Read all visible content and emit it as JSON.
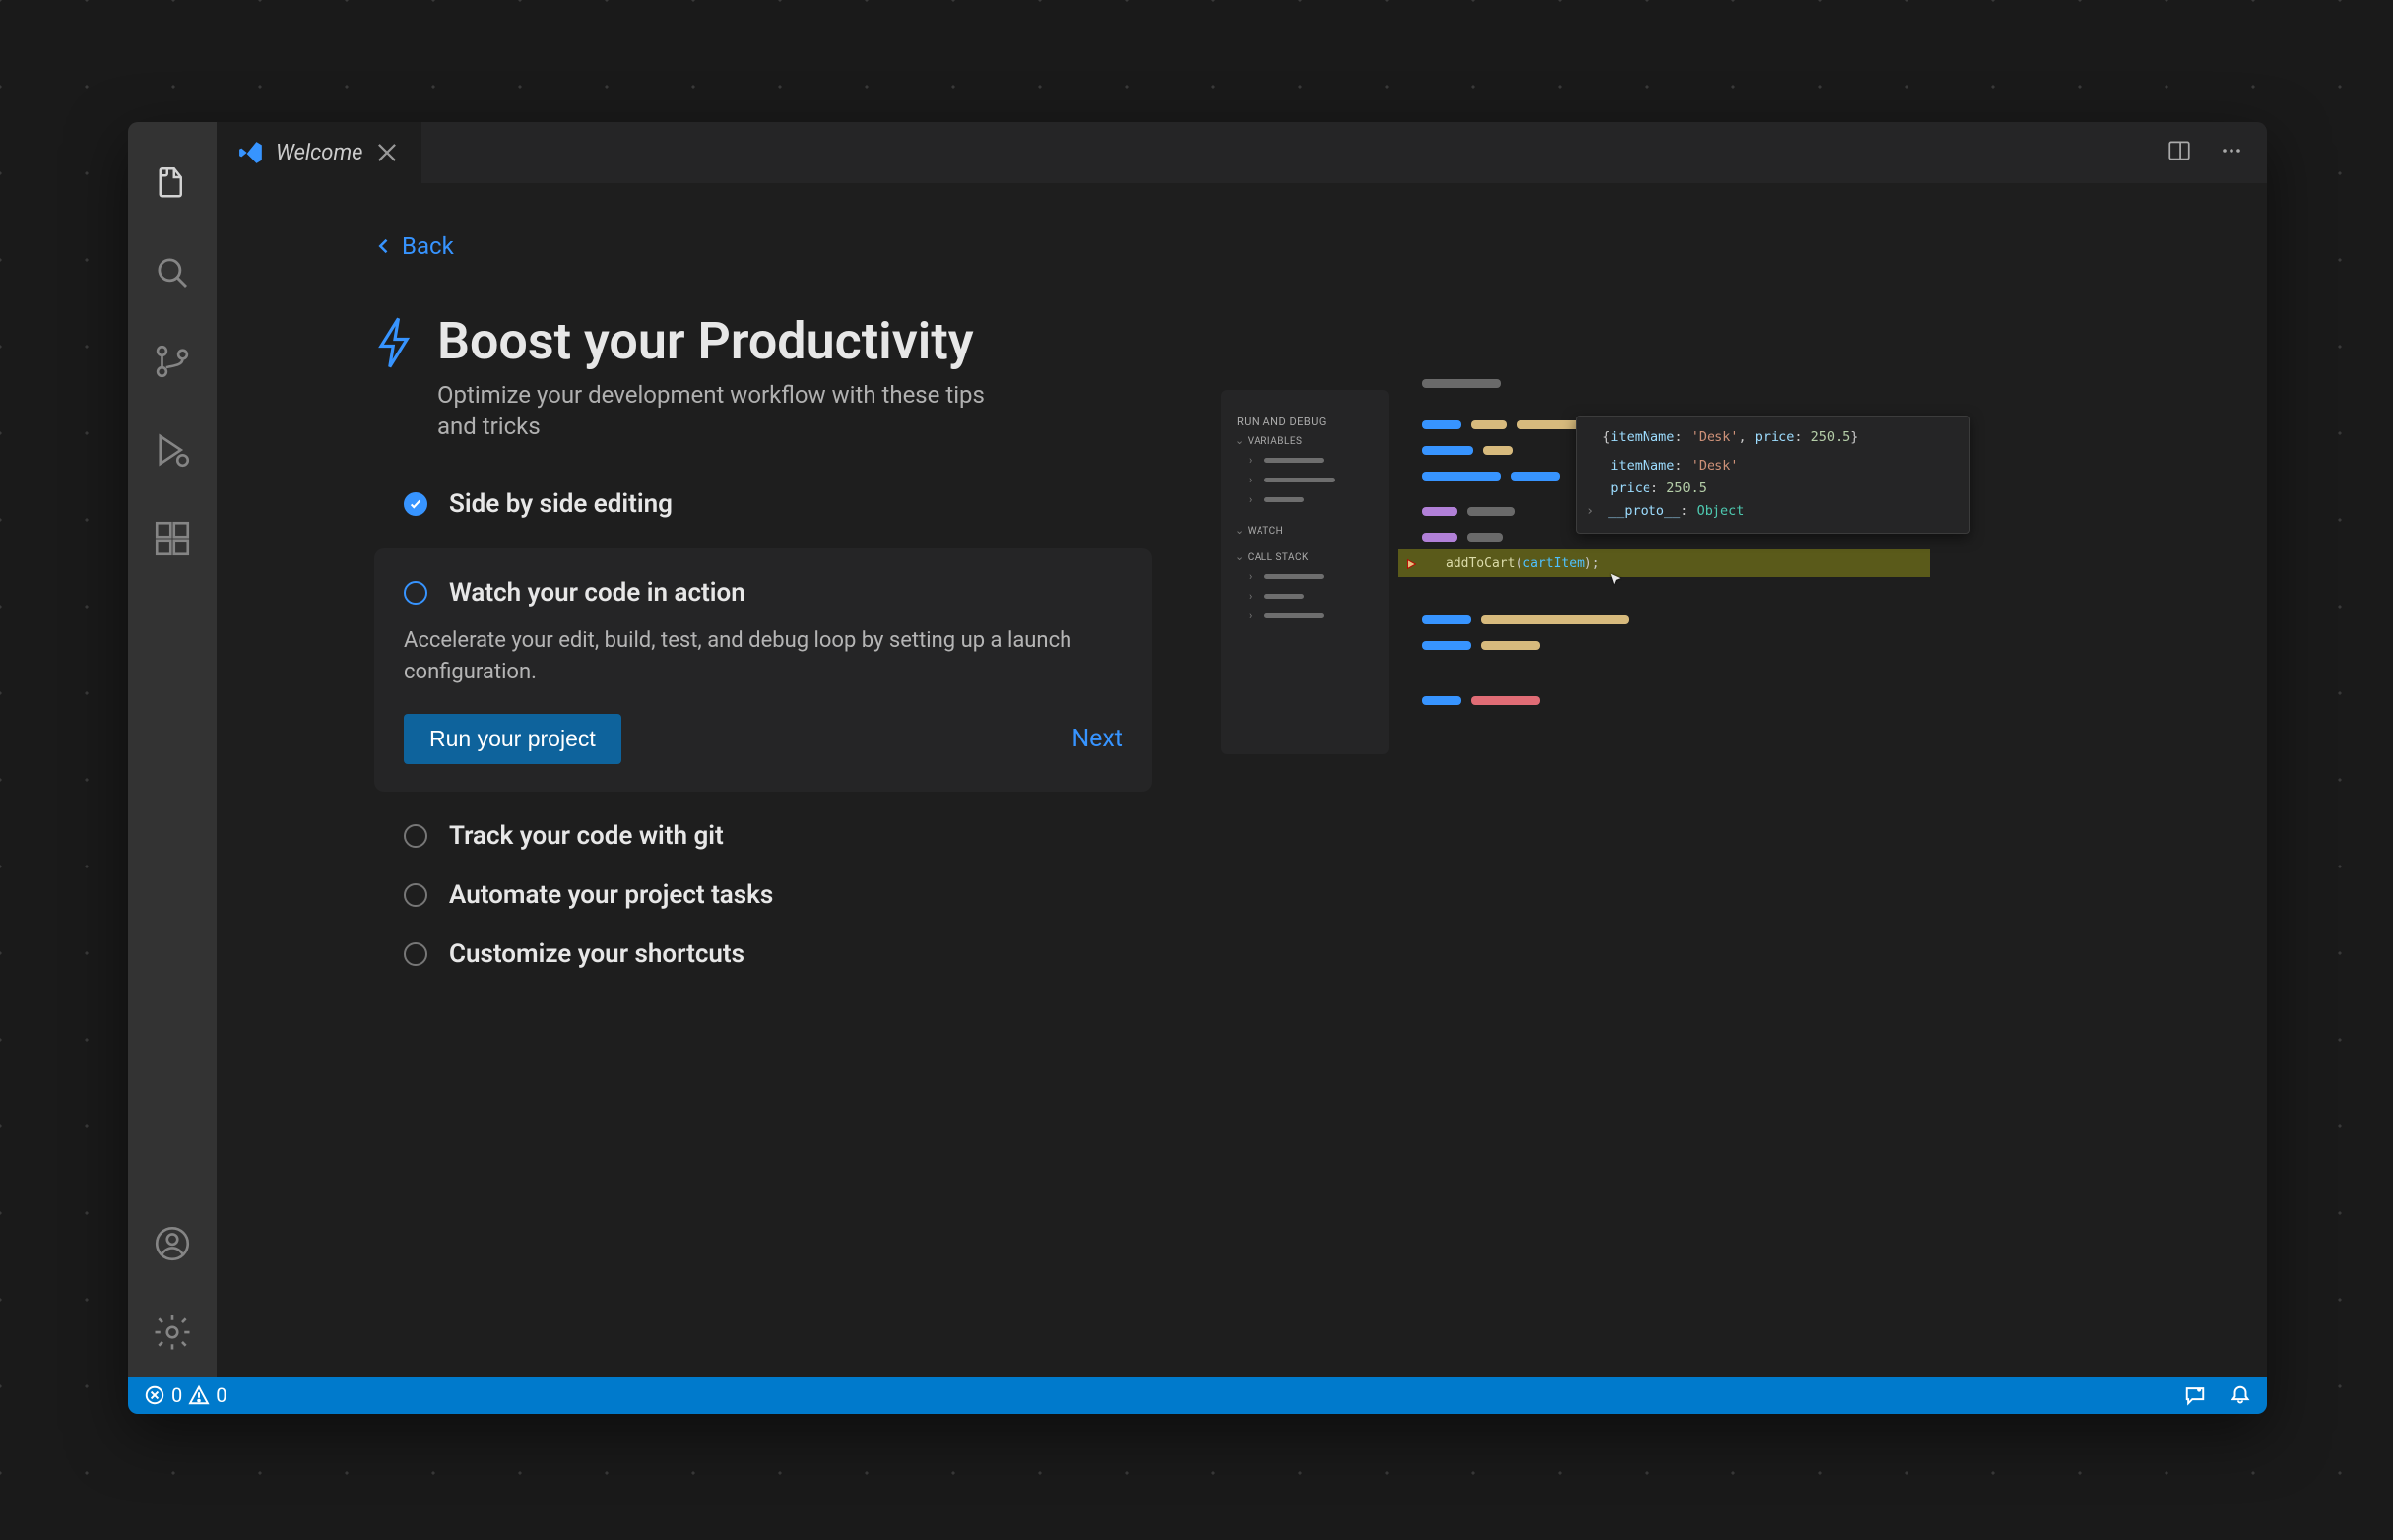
{
  "tab": {
    "title": "Welcome"
  },
  "back": {
    "label": "Back"
  },
  "header": {
    "title": "Boost your Productivity",
    "subtitle": "Optimize your development workflow with these tips and tricks"
  },
  "steps": {
    "done": {
      "label": "Side by side editing"
    },
    "active": {
      "label": "Watch your code in action",
      "desc": "Accelerate your edit, build, test, and debug loop by setting up a launch configuration.",
      "cta": "Run your project",
      "next": "Next"
    },
    "rest": [
      {
        "label": "Track your code with git"
      },
      {
        "label": "Automate your project tasks"
      },
      {
        "label": "Customize your shortcuts"
      }
    ]
  },
  "illus": {
    "run_and_debug": "RUN AND DEBUG",
    "variables": "VARIABLES",
    "watch": "WATCH",
    "call_stack": "CALL STACK",
    "tooltip": {
      "summary_open": "{",
      "summary_key1": "itemName",
      "summary_val1": "'Desk'",
      "summary_sep": ", ",
      "summary_key2": "price",
      "summary_val2": "250.5",
      "summary_close": "}",
      "l1_key": "itemName",
      "l1_val": "'Desk'",
      "l2_key": "price",
      "l2_val": "250.5",
      "l3_key": "__proto__",
      "l3_val": "Object"
    },
    "code": {
      "fn": "addToCart",
      "arg": "cartItem"
    }
  },
  "status": {
    "errors": "0",
    "warnings": "0"
  }
}
